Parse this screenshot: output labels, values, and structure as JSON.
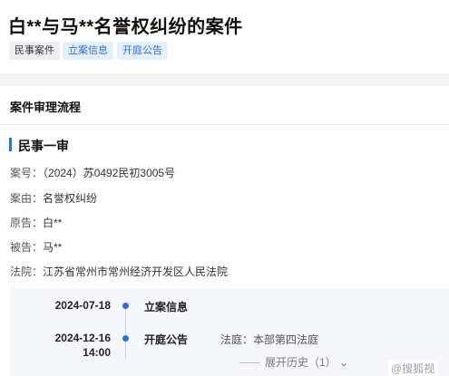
{
  "case": {
    "title": "白**与马**名誉权纠纷的案件",
    "tags": [
      "民事案件",
      "立案信息",
      "开庭公告"
    ]
  },
  "process": {
    "section_title": "案件审理流程",
    "stage_title": "民事一审",
    "fields": [
      {
        "label": "案号：",
        "value": "（2024）苏0492民初3005号"
      },
      {
        "label": "案由：",
        "value": "名誉权纠纷"
      },
      {
        "label": "原告：",
        "value": "白**"
      },
      {
        "label": "被告：",
        "value": "马**"
      },
      {
        "label": "法院：",
        "value": "江苏省常州市常州经济开发区人民法院"
      }
    ],
    "timeline": [
      {
        "date": "2024-07-18",
        "time": "",
        "event": "立案信息",
        "detail": ""
      },
      {
        "date": "2024-12-16",
        "time": "14:00",
        "event": "开庭公告",
        "detail": "法庭：本部第四法庭"
      }
    ],
    "expand_label": "展开历史（1）",
    "expand_chevron": "⌄"
  },
  "watermark": "@搜狐视"
}
